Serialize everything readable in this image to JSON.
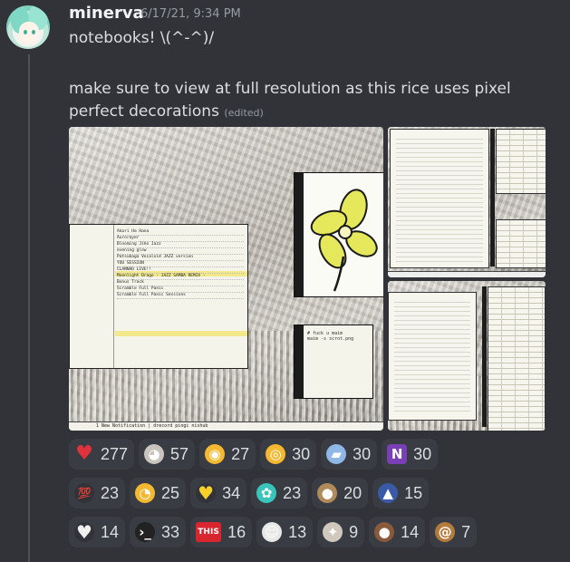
{
  "message": {
    "username": "minerva",
    "timestamp": "6/17/21, 9:34 PM",
    "line1": "notebooks! \\(^-^)/",
    "line2": "make sure to view at full resolution as this rice uses pixel perfect decorations",
    "edited_label": "(edited)"
  },
  "screenshots": {
    "status_text": "1 New Notification | drecord pingi nishub",
    "music_rows": [
      "Akari Ha Hana",
      "Aurorayer",
      "Blooming Jiho Jazz",
      "evening glow",
      "Patsubaga Vocaloid JAZZ version",
      "YOU SESSION",
      "CLANNAD LIVE!!",
      "Moonlight Drago - JAZZ SAMBA REMIX -",
      "Bonus Track",
      "Scramble Full Panic",
      "Scramble Full Panic Sessions"
    ],
    "terminal_lines": [
      "# fuck u maim",
      "maim -s scrot.png"
    ]
  },
  "reactions": [
    {
      "icon": "heart-icon",
      "count": "277",
      "color": "#e0323a",
      "glyph": "♥"
    },
    {
      "icon": "cat-icon",
      "count": "57",
      "color": "#c9c4bd",
      "glyph": "◕"
    },
    {
      "icon": "heart-eyes-sunglasses-icon",
      "count": "27",
      "color": "#f4b931",
      "glyph": "◉"
    },
    {
      "icon": "flushed-face-icon",
      "count": "30",
      "color": "#f4b931",
      "glyph": "◎"
    },
    {
      "icon": "notebook-icon",
      "count": "30",
      "color": "#8fb8e6",
      "glyph": "▰"
    },
    {
      "icon": "onenote-icon",
      "count": "30",
      "color": "#7b3fb5",
      "glyph": "N"
    },
    {
      "icon": "hundred-points-icon",
      "count": "23",
      "color": "#323339",
      "glyph": "💯"
    },
    {
      "icon": "pinching-face-icon",
      "count": "25",
      "color": "#f4b931",
      "glyph": "◔"
    },
    {
      "icon": "yellow-heart-icon",
      "count": "34",
      "color": "#323339",
      "glyph": "♥"
    },
    {
      "icon": "miku-icon",
      "count": "23",
      "color": "#39c5bb",
      "glyph": "✿"
    },
    {
      "icon": "meme-face-icon",
      "count": "20",
      "color": "#b08a5a",
      "glyph": "●"
    },
    {
      "icon": "penguin-icon",
      "count": "15",
      "color": "#3a5aa8",
      "glyph": "▲"
    },
    {
      "icon": "white-heart-icon",
      "count": "14",
      "color": "#323339",
      "glyph": "♥"
    },
    {
      "icon": "terminal-rainbow-icon",
      "count": "33",
      "color": "#222222",
      "glyph": "›_"
    },
    {
      "icon": "this-icon",
      "count": "16",
      "color": "#d8262e",
      "glyph": "THIS"
    },
    {
      "icon": "ghost-person-icon",
      "count": "13",
      "color": "#e8e8e8",
      "glyph": "☺"
    },
    {
      "icon": "bone-icon",
      "count": "9",
      "color": "#cfc9bd",
      "glyph": "✦"
    },
    {
      "icon": "poop-icon",
      "count": "14",
      "color": "#8a5a3c",
      "glyph": "●"
    },
    {
      "icon": "snail-icon",
      "count": "7",
      "color": "#b57b3d",
      "glyph": "@"
    }
  ]
}
